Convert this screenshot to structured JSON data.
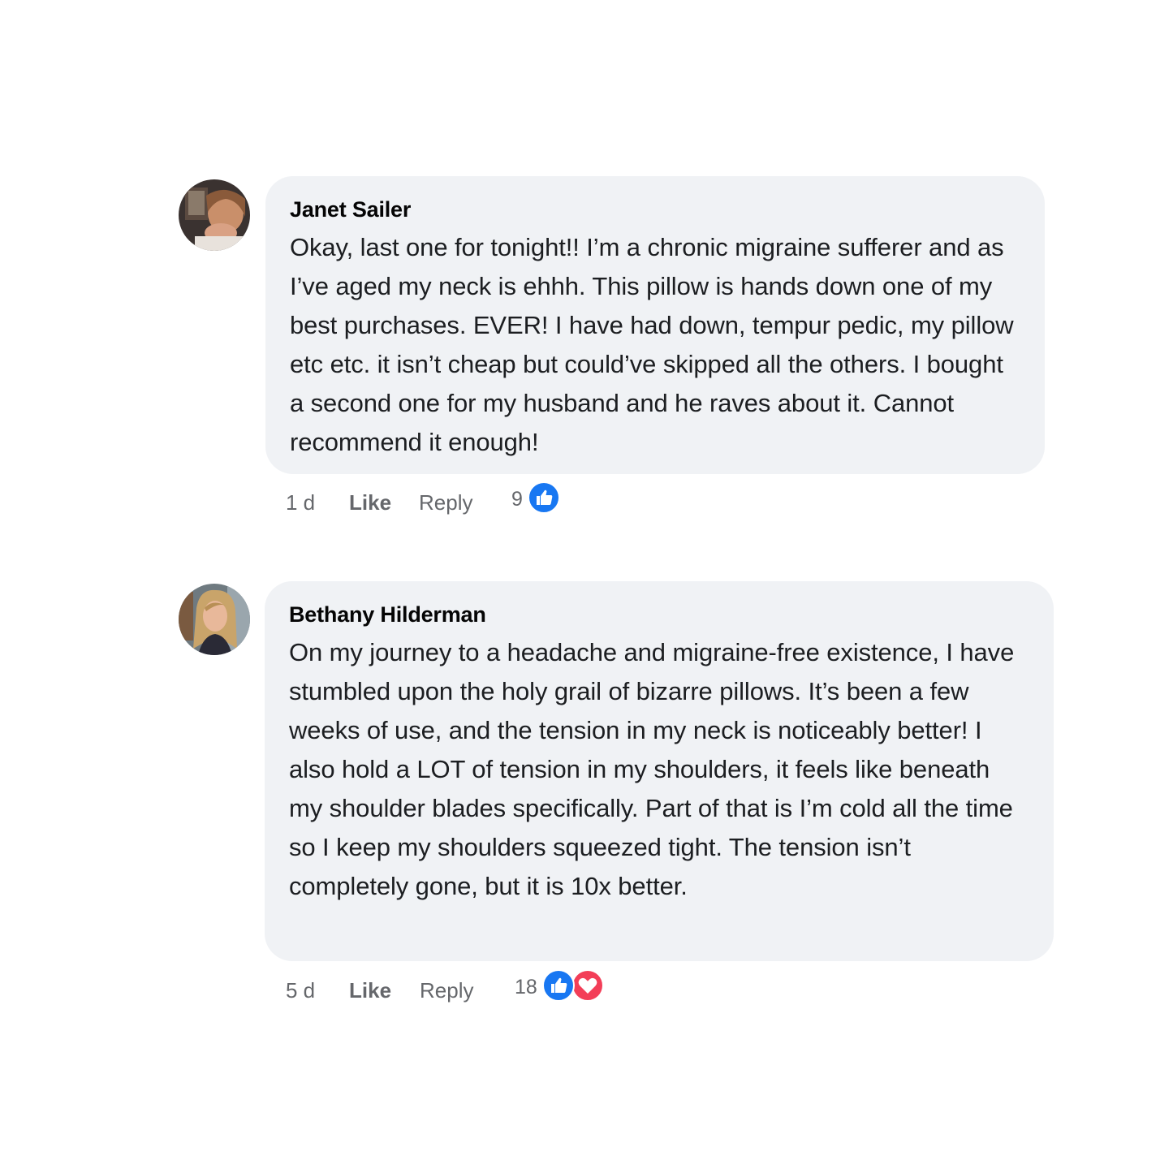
{
  "comments": [
    {
      "author": "Janet Sailer",
      "text": "Okay, last one for tonight!! I’m a chronic migraine sufferer and as I’ve aged my neck is ehhh. This pillow is hands down one of my best purchases. EVER! I have had down, tempur pedic, my pillow etc etc. it isn’t cheap but could’ve skipped all the others. I bought a second one for my husband and he raves about it. Cannot recommend it enough!",
      "time": "1 d",
      "like_label": "Like",
      "reply_label": "Reply",
      "reaction_count": "9",
      "reactions": [
        "like-icon"
      ]
    },
    {
      "author": "Bethany Hilderman",
      "text": "On my journey to a headache and migraine-free existence, I have stumbled upon the holy grail of bizarre pillows. It’s been a few weeks of use, and the tension in my neck is noticeably better! I also hold a LOT of tension in my shoulders, it feels like beneath my shoulder blades specifically. Part of that is I’m cold all the time so I keep my shoulders squeezed tight. The tension isn’t completely gone, but it is 10x better.",
      "time": "5 d",
      "like_label": "Like",
      "reply_label": "Reply",
      "reaction_count": "18",
      "reactions": [
        "like-icon",
        "love-icon"
      ]
    }
  ],
  "colors": {
    "bubble": "#f0f2f5",
    "like_blue": "#1877f2",
    "love_red": "#f33e58",
    "meta_gray": "#65676b"
  }
}
